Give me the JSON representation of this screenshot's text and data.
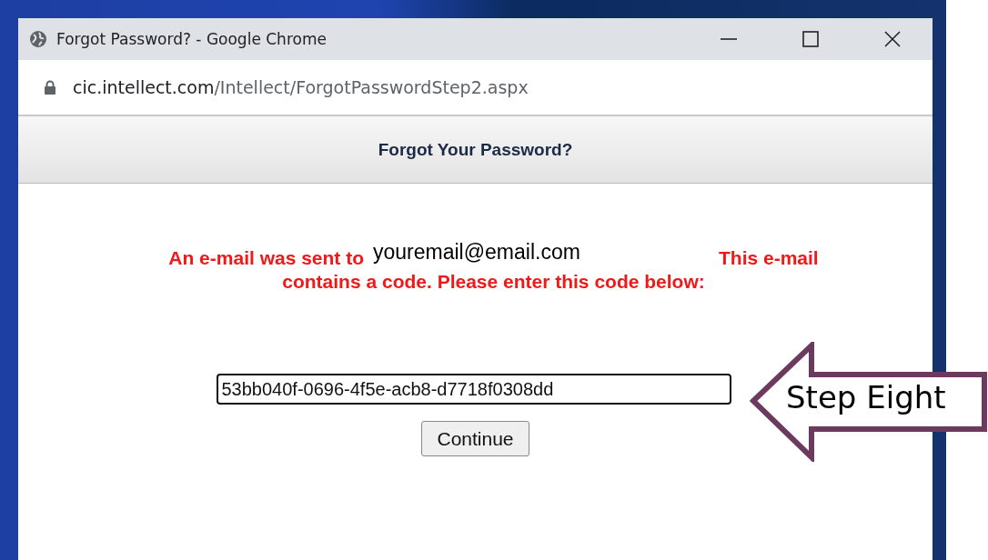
{
  "window": {
    "title": "Forgot Password? - Google Chrome"
  },
  "address_bar": {
    "domain": "cic.intellect.com",
    "path": "/Intellect/ForgotPasswordStep2.aspx"
  },
  "page": {
    "heading": "Forgot Your Password?",
    "message_lines": [
      "An e-mail was sent to",
      "This e-mail",
      "contains a code. Please enter this code below:"
    ],
    "email_overlay": "youremail@email.com",
    "code_field": {
      "value": "53bb040f-0696-4f5e-acb8-d7718f0308dd"
    },
    "continue_button": "Continue"
  },
  "callout": {
    "label": "Step Eight"
  }
}
